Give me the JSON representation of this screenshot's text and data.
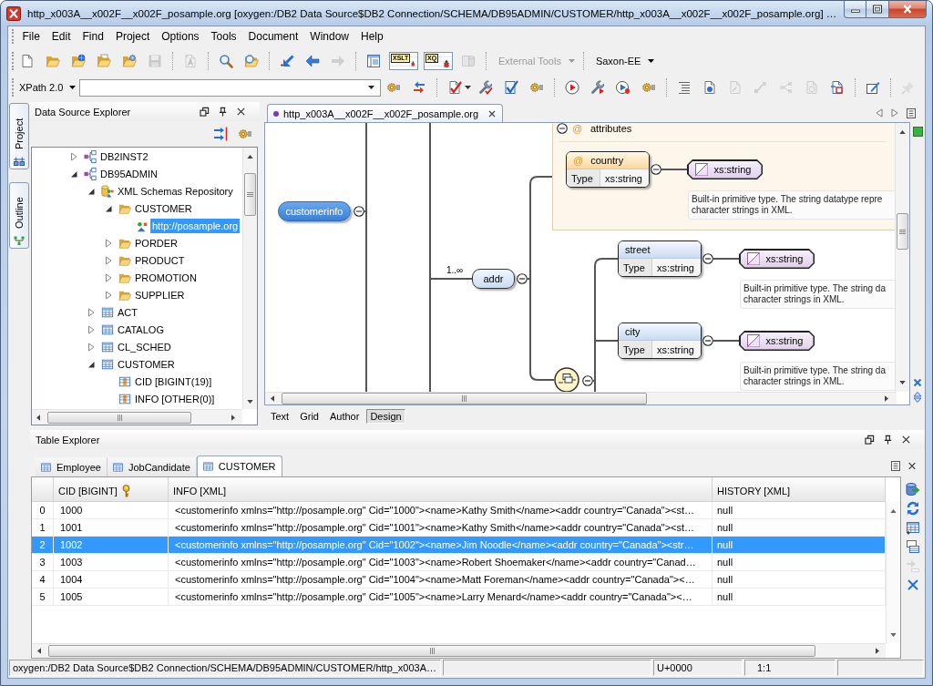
{
  "window": {
    "title": "http_x003A__x002F__x002F_posample.org [oxygen:/DB2 Data Source$DB2 Connection/SCHEMA/DB95ADMIN/CUSTOMER/http_x003A__x002F__x002F_posample.org] …"
  },
  "menu": [
    "File",
    "Edit",
    "Find",
    "Project",
    "Options",
    "Tools",
    "Document",
    "Window",
    "Help"
  ],
  "main_toolbar": {
    "groups": [
      [
        {
          "disabled": false
        },
        {
          "disabled": false
        },
        {
          "disabled": false
        },
        {
          "disabled": false
        },
        {
          "disabled": false
        },
        {
          "disabled": true
        }
      ],
      [
        {
          "disabled": true
        }
      ],
      [
        {
          "disabled": false
        },
        {
          "disabled": false
        }
      ],
      [
        {
          "disabled": false
        },
        {
          "disabled": false
        },
        {
          "disabled": true
        }
      ],
      [
        {
          "disabled": false
        },
        {
          "disabled": false,
          "badge": "XSLT"
        },
        {
          "disabled": false,
          "badge": "XQ"
        },
        {
          "disabled": true
        }
      ]
    ],
    "external_tools": {
      "label": "External Tools",
      "disabled": true
    },
    "engine": {
      "label": "Saxon-EE"
    }
  },
  "xpath_toolbar": {
    "version": "XPath 2.0",
    "groups": [
      [
        {
          "disabled": false
        },
        {
          "disabled": false
        }
      ],
      [
        {
          "disabled": false
        },
        {
          "disabled": false
        },
        {
          "disabled": false
        },
        {
          "disabled": false
        }
      ],
      [
        {
          "disabled": false
        },
        {
          "disabled": false
        },
        {
          "disabled": false
        },
        {
          "disabled": false
        }
      ],
      [
        {
          "disabled": false
        },
        {
          "disabled": false
        },
        {
          "disabled": true
        },
        {
          "disabled": true
        },
        {
          "disabled": true
        },
        {
          "disabled": true
        },
        {
          "disabled": false
        }
      ],
      [
        {
          "disabled": false
        }
      ],
      [
        {
          "disabled": true
        }
      ]
    ]
  },
  "side_tabs": [
    {
      "label": "Project"
    },
    {
      "label": "Outline"
    }
  ],
  "data_source_explorer": {
    "title": "Data Source Explorer",
    "tree": [
      {
        "label": "DB2INST2",
        "kind": "schema",
        "expanded": false,
        "selected": false
      },
      {
        "label": "DB95ADMIN",
        "kind": "schema",
        "expanded": true,
        "selected": false,
        "children": [
          {
            "label": "XML Schemas Repository",
            "kind": "repository",
            "expanded": true,
            "selected": false,
            "children": [
              {
                "label": "CUSTOMER",
                "kind": "folder",
                "expanded": true,
                "selected": false,
                "children": [
                  {
                    "label": "http://posample.org",
                    "kind": "xml-schema",
                    "selected": true
                  }
                ]
              },
              {
                "label": "PORDER",
                "kind": "folder",
                "expanded": false,
                "selected": false
              },
              {
                "label": "PRODUCT",
                "kind": "folder",
                "expanded": false,
                "selected": false
              },
              {
                "label": "PROMOTION",
                "kind": "folder",
                "expanded": false,
                "selected": false
              },
              {
                "label": "SUPPLIER",
                "kind": "folder",
                "expanded": false,
                "selected": false
              }
            ]
          },
          {
            "label": "ACT",
            "kind": "table",
            "expanded": false,
            "selected": false
          },
          {
            "label": "CATALOG",
            "kind": "table",
            "expanded": false,
            "selected": false
          },
          {
            "label": "CL_SCHED",
            "kind": "table",
            "expanded": false,
            "selected": false
          },
          {
            "label": "CUSTOMER",
            "kind": "table",
            "expanded": true,
            "selected": false,
            "children": [
              {
                "label": "CID [BIGINT(19)]",
                "kind": "column",
                "selected": false
              },
              {
                "label": "INFO [OTHER(0)]",
                "kind": "column",
                "selected": false
              }
            ]
          }
        ]
      }
    ]
  },
  "editor": {
    "tab": {
      "label": "http_x003A__x002F__x002F_posample.org"
    },
    "diagram": {
      "root": {
        "name": "customerinfo",
        "selected": true,
        "expanded": true
      },
      "child": {
        "name": "addr",
        "occurs": "1..∞",
        "selected": false,
        "expanded": true
      },
      "attributes": {
        "marker": "@",
        "label": "attributes",
        "expanded": true,
        "items": [
          {
            "marker": "@",
            "name": "country",
            "type_label": "Type",
            "type": "xs:string",
            "selected": false,
            "expanded": true,
            "type_node": {
              "name": "xs:string",
              "selected": false,
              "description": [
                "Built-in primitive type. The string datatype repre",
                "character strings in XML."
              ]
            }
          }
        ]
      },
      "compositor": {
        "expanded": true,
        "items": [
          {
            "name": "street",
            "type_label": "Type",
            "type": "xs:string",
            "selected": false,
            "expanded": true,
            "type_node": {
              "name": "xs:string",
              "selected": false,
              "description": [
                "Built-in primitive type. The string da",
                "character strings in XML."
              ]
            }
          },
          {
            "name": "city",
            "type_label": "Type",
            "type": "xs:string",
            "selected": false,
            "expanded": true,
            "type_node": {
              "name": "xs:string",
              "selected": false,
              "description": [
                "Built-in primitive type. The string da",
                "character strings in XML."
              ]
            }
          }
        ]
      }
    },
    "modes": [
      {
        "label": "Text",
        "selected": false
      },
      {
        "label": "Grid",
        "selected": false
      },
      {
        "label": "Author",
        "selected": false
      },
      {
        "label": "Design",
        "selected": true
      }
    ]
  },
  "table_explorer": {
    "title": "Table Explorer",
    "tabs": [
      {
        "label": "Employee",
        "selected": false
      },
      {
        "label": "JobCandidate",
        "selected": false
      },
      {
        "label": "CUSTOMER",
        "selected": true
      }
    ],
    "columns": [
      {
        "label": "CID [BIGINT]",
        "primary_key": true
      },
      {
        "label": "INFO [XML]",
        "primary_key": false
      },
      {
        "label": "HISTORY [XML]",
        "primary_key": false
      }
    ],
    "rows": [
      {
        "index": "0",
        "selected": false,
        "cells": [
          "1000",
          "<customerinfo xmlns=\"http://posample.org\" Cid=\"1000\"><name>Kathy Smith</name><addr country=\"Canada\"><st…",
          "null"
        ]
      },
      {
        "index": "1",
        "selected": false,
        "cells": [
          "1001",
          "<customerinfo xmlns=\"http://posample.org\" Cid=\"1001\"><name>Kathy Smith</name><addr country=\"Canada\"><st…",
          "null"
        ]
      },
      {
        "index": "2",
        "selected": true,
        "cells": [
          "1002",
          "<customerinfo xmlns=\"http://posample.org\" Cid=\"1002\"><name>Jim Noodle</name><addr country=\"Canada\"><str…",
          "null"
        ]
      },
      {
        "index": "3",
        "selected": false,
        "cells": [
          "1003",
          "<customerinfo xmlns=\"http://posample.org\" Cid=\"1003\"><name>Robert Shoemaker</name><addr country=\"Canad…",
          "null"
        ]
      },
      {
        "index": "4",
        "selected": false,
        "cells": [
          "1004",
          "<customerinfo xmlns=\"http://posample.org\" Cid=\"1004\"><name>Matt Foreman</name><addr country=\"Canada\"><…",
          "null"
        ]
      },
      {
        "index": "5",
        "selected": false,
        "cells": [
          "1005",
          "<customerinfo xmlns=\"http://posample.org\" Cid=\"1005\"><name>Larry Menard</name><addr country=\"Canada\"><…",
          "null"
        ]
      }
    ],
    "actions": [
      {
        "disabled": false
      },
      {
        "disabled": false
      },
      {
        "disabled": false
      },
      {
        "disabled": false
      },
      {
        "disabled": true
      },
      {
        "disabled": false
      }
    ]
  },
  "status_bar": {
    "path": "oxygen:/DB2 Data Source$DB2 Connection/SCHEMA/DB95ADMIN/CUSTOMER/http_x003A…",
    "character": "U+0000",
    "position": "1:1"
  }
}
